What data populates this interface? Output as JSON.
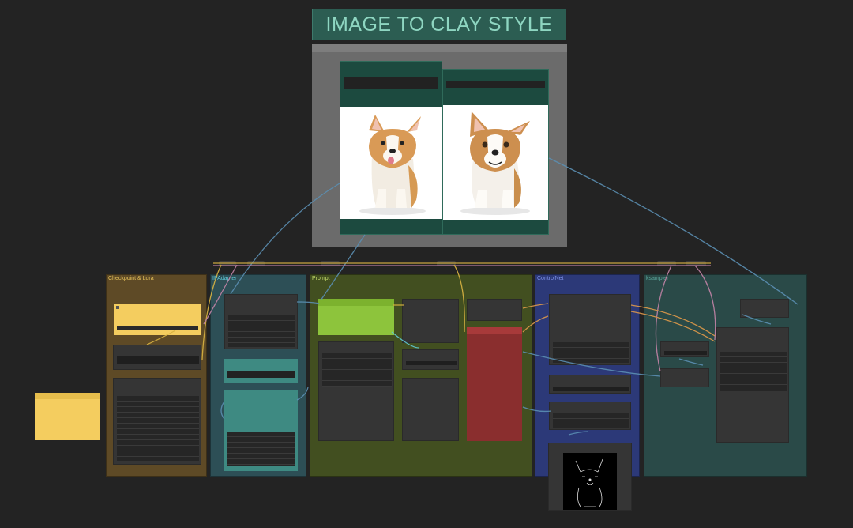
{
  "workflow": {
    "title": "IMAGE TO CLAY STYLE"
  },
  "groups": [
    {
      "key": "checkpoint",
      "label": "Checkpoint & Lora",
      "color": "#5e4a26",
      "title_color": "#e6c15a"
    },
    {
      "key": "ipadapter",
      "label": "IPAdapter",
      "color": "#2d4f56",
      "title_color": "#5fc8d4"
    },
    {
      "key": "prompt",
      "label": "Prompt",
      "color": "#424f20",
      "title_color": "#c4dc6a"
    },
    {
      "key": "controlnet",
      "label": "ControlNet",
      "color": "#2c3978",
      "title_color": "#7e92ea"
    },
    {
      "key": "ksampler",
      "label": "ksampler",
      "color": "#2a4a48",
      "title_color": "#5aa59b"
    }
  ],
  "compare": {
    "left_image": "corgi-photo",
    "right_image": "corgi-clay"
  },
  "colors": {
    "canvas": "#232323",
    "yellow_node": "#f4cd5f",
    "green_node": "#8dc43c",
    "red_node": "#8a2e2e",
    "teal_node": "#3e8a82"
  }
}
